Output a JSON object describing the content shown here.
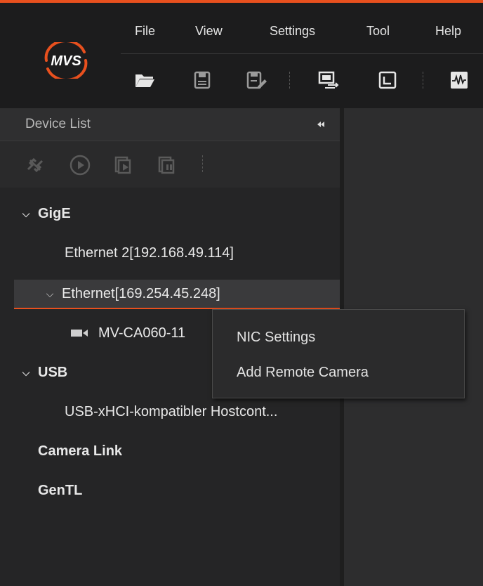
{
  "menu": {
    "items": [
      {
        "label": "File"
      },
      {
        "label": "View"
      },
      {
        "label": "Settings"
      },
      {
        "label": "Tool"
      },
      {
        "label": "Help"
      }
    ]
  },
  "toolbar": {
    "icons": [
      "open-folder-icon",
      "save-icon",
      "save-as-icon",
      "device-switch-icon",
      "fullscreen-icon",
      "waveform-icon"
    ]
  },
  "device_panel": {
    "title": "Device List",
    "tree": {
      "gige": "GigE",
      "eth2": "Ethernet 2[192.168.49.114]",
      "eth": "Ethernet[169.254.45.248]",
      "camera": "MV-CA060-11",
      "usb": "USB",
      "usb_ctrl": "USB-xHCI-kompatibler Hostcont...",
      "camlink": "Camera Link",
      "gentl": "GenTL"
    }
  },
  "context_menu": {
    "items": [
      {
        "label": "NIC Settings"
      },
      {
        "label": "Add Remote Camera"
      }
    ]
  },
  "colors": {
    "accent": "#e8501e",
    "background": "#2a2a2a"
  }
}
